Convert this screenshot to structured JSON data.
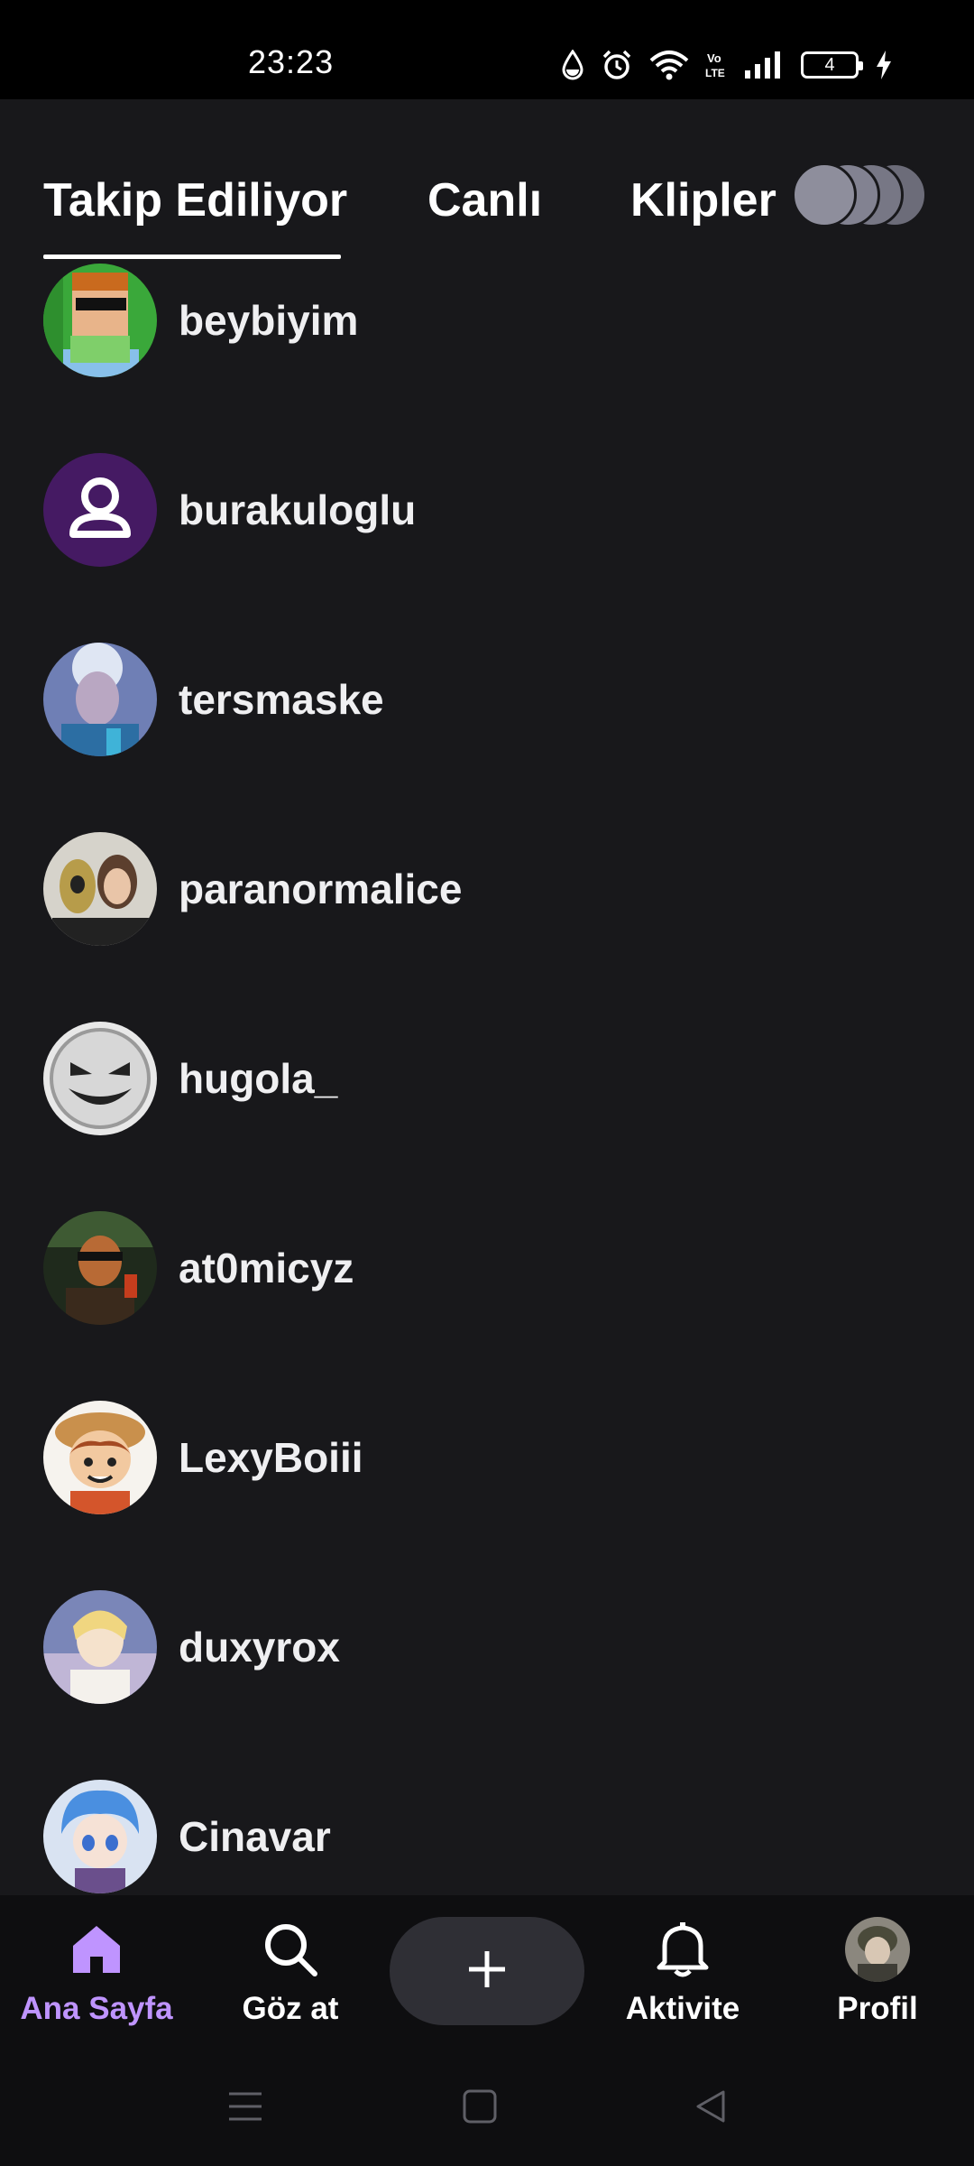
{
  "status_bar": {
    "time": "23:23",
    "battery_level": "4",
    "icons": [
      "water-drop-icon",
      "alarm-icon",
      "wifi-icon",
      "volte-icon",
      "signal-icon",
      "battery-icon",
      "charging-icon"
    ],
    "volte_label": "Vo LTE"
  },
  "tabs": [
    {
      "label": "Takip Ediliyor",
      "active": true
    },
    {
      "label": "Canlı",
      "active": false
    },
    {
      "label": "Klipler",
      "active": false
    }
  ],
  "channels": [
    {
      "name": "beybiyim"
    },
    {
      "name": "burakuloglu"
    },
    {
      "name": "tersmaske"
    },
    {
      "name": "paranormalice"
    },
    {
      "name": "hugola_"
    },
    {
      "name": "at0micyz"
    },
    {
      "name": "LexyBoiii"
    },
    {
      "name": "duxyrox"
    },
    {
      "name": "Cinavar"
    }
  ],
  "bottom_nav": {
    "home": "Ana Sayfa",
    "browse": "Göz at",
    "activity": "Aktivite",
    "profile": "Profil"
  },
  "colors": {
    "background": "#18181b",
    "accent": "#bf94ff",
    "nav_background": "#0e0e10",
    "create_button": "#2f2f35"
  }
}
